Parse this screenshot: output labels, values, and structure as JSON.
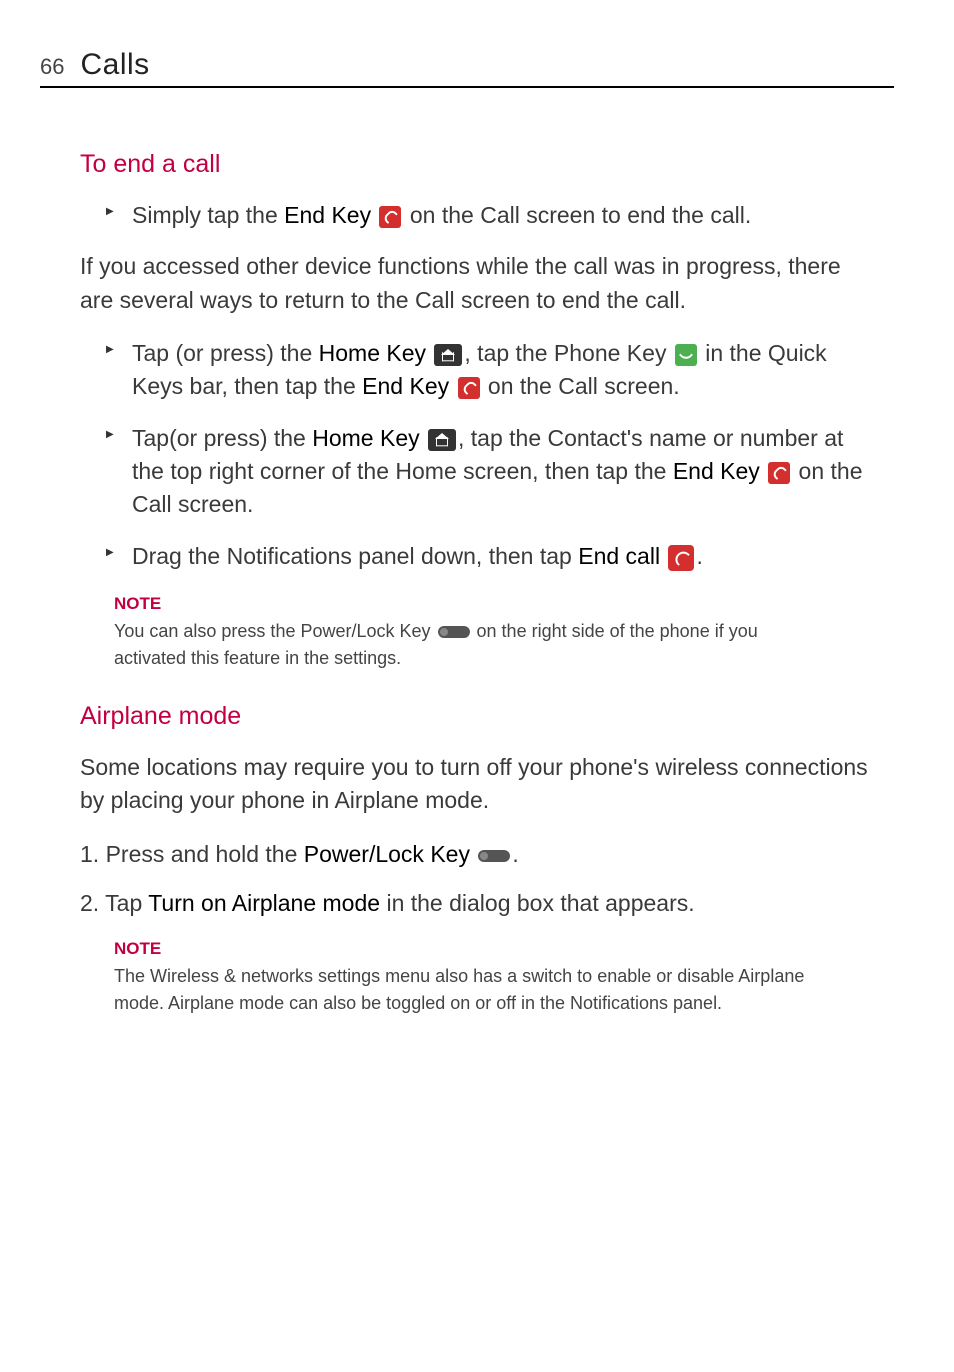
{
  "header": {
    "page_number": "66",
    "chapter_title": "Calls"
  },
  "section1": {
    "heading": "To end a call",
    "bullet1_pre": "Simply tap the ",
    "bullet1_bold": "End Key ",
    "bullet1_post": " on the Call screen to end the call.",
    "para1": "If you accessed other device functions while the call was in progress, there are several ways to return to the Call screen to end the call.",
    "bullet2_a": "Tap (or press) the ",
    "bullet2_b": "Home Key ",
    "bullet2_c": ", tap the Phone Key ",
    "bullet2_d": " in the Quick Keys bar, then tap the ",
    "bullet2_e": "End Key ",
    "bullet2_f": " on the Call screen.",
    "bullet3_a": "Tap(or press) the ",
    "bullet3_b": "Home Key ",
    "bullet3_c": ", tap the Contact's name or number at the top right corner of the Home screen, then tap the ",
    "bullet3_d": "End Key ",
    "bullet3_e": " on the Call screen.",
    "bullet4_a": "Drag the Notifications panel down, then tap ",
    "bullet4_b": "End call ",
    "bullet4_c": ".",
    "note_label": "NOTE",
    "note_a": "You can also press the Power/Lock Key ",
    "note_b": " on the right side of the phone if you activated this feature in the settings."
  },
  "section2": {
    "heading": "Airplane mode",
    "para1": "Some locations may require you to turn off your phone's wireless connections by placing your phone in Airplane mode.",
    "step1_num": "1. ",
    "step1_a": "Press and hold the ",
    "step1_b": "Power/Lock Key ",
    "step1_c": ".",
    "step2_num": "2. ",
    "step2_a": "Tap ",
    "step2_b": "Turn on Airplane mode",
    "step2_c": " in the dialog box that appears.",
    "note_label": "NOTE",
    "note_text": "The Wireless & networks settings menu also has a switch to enable or disable Airplane mode. Airplane mode can also be toggled on or off in the Notifications panel."
  }
}
